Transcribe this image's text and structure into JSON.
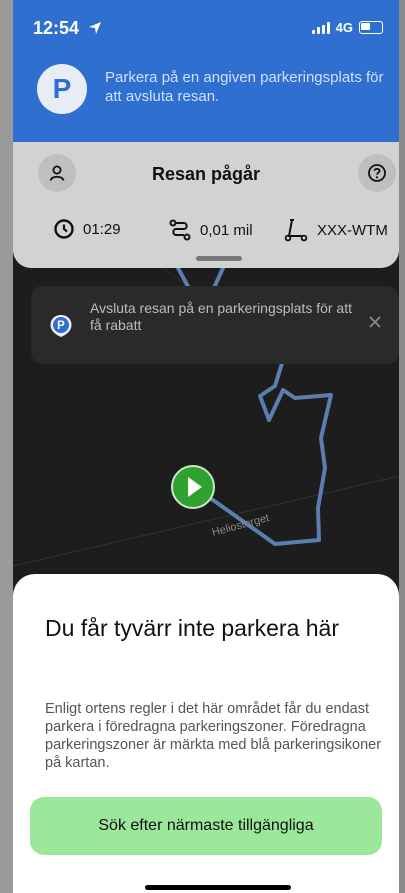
{
  "status_bar": {
    "time": "12:54",
    "network": "4G"
  },
  "banner": {
    "icon_letter": "P",
    "text": "Parkera på en angiven parkeringsplats för att avsluta resan."
  },
  "trip": {
    "title": "Resan pågår",
    "duration": "01:29",
    "distance": "0,01 mil",
    "vehicle_id": "XXX-WTM"
  },
  "map": {
    "street_label": "Heliostorget"
  },
  "toast": {
    "icon_letter": "P",
    "text": "Avsluta resan på en parkeringsplats för att få rabatt"
  },
  "sheet": {
    "title": "Du får tyvärr inte parkera här",
    "body": "Enligt ortens regler i det här området får du endast parkera i föredragna parkeringszoner. Föredragna parkeringszoner är märkta med blå parkeringsikoner på kartan.",
    "cta_label": "Sök efter närmaste tillgängliga"
  },
  "colors": {
    "banner_bg": "#2f6fd0",
    "trip_card_bg": "#d2d2d2",
    "route_line": "#5a7fae",
    "start_marker": "#2fa12f",
    "cta_bg": "#9be89b"
  },
  "icons": {
    "location": "location-arrow-icon",
    "user": "user-icon",
    "help": "question-icon",
    "clock": "clock-icon",
    "route": "route-icon",
    "scooter": "scooter-icon",
    "close": "close-icon"
  }
}
